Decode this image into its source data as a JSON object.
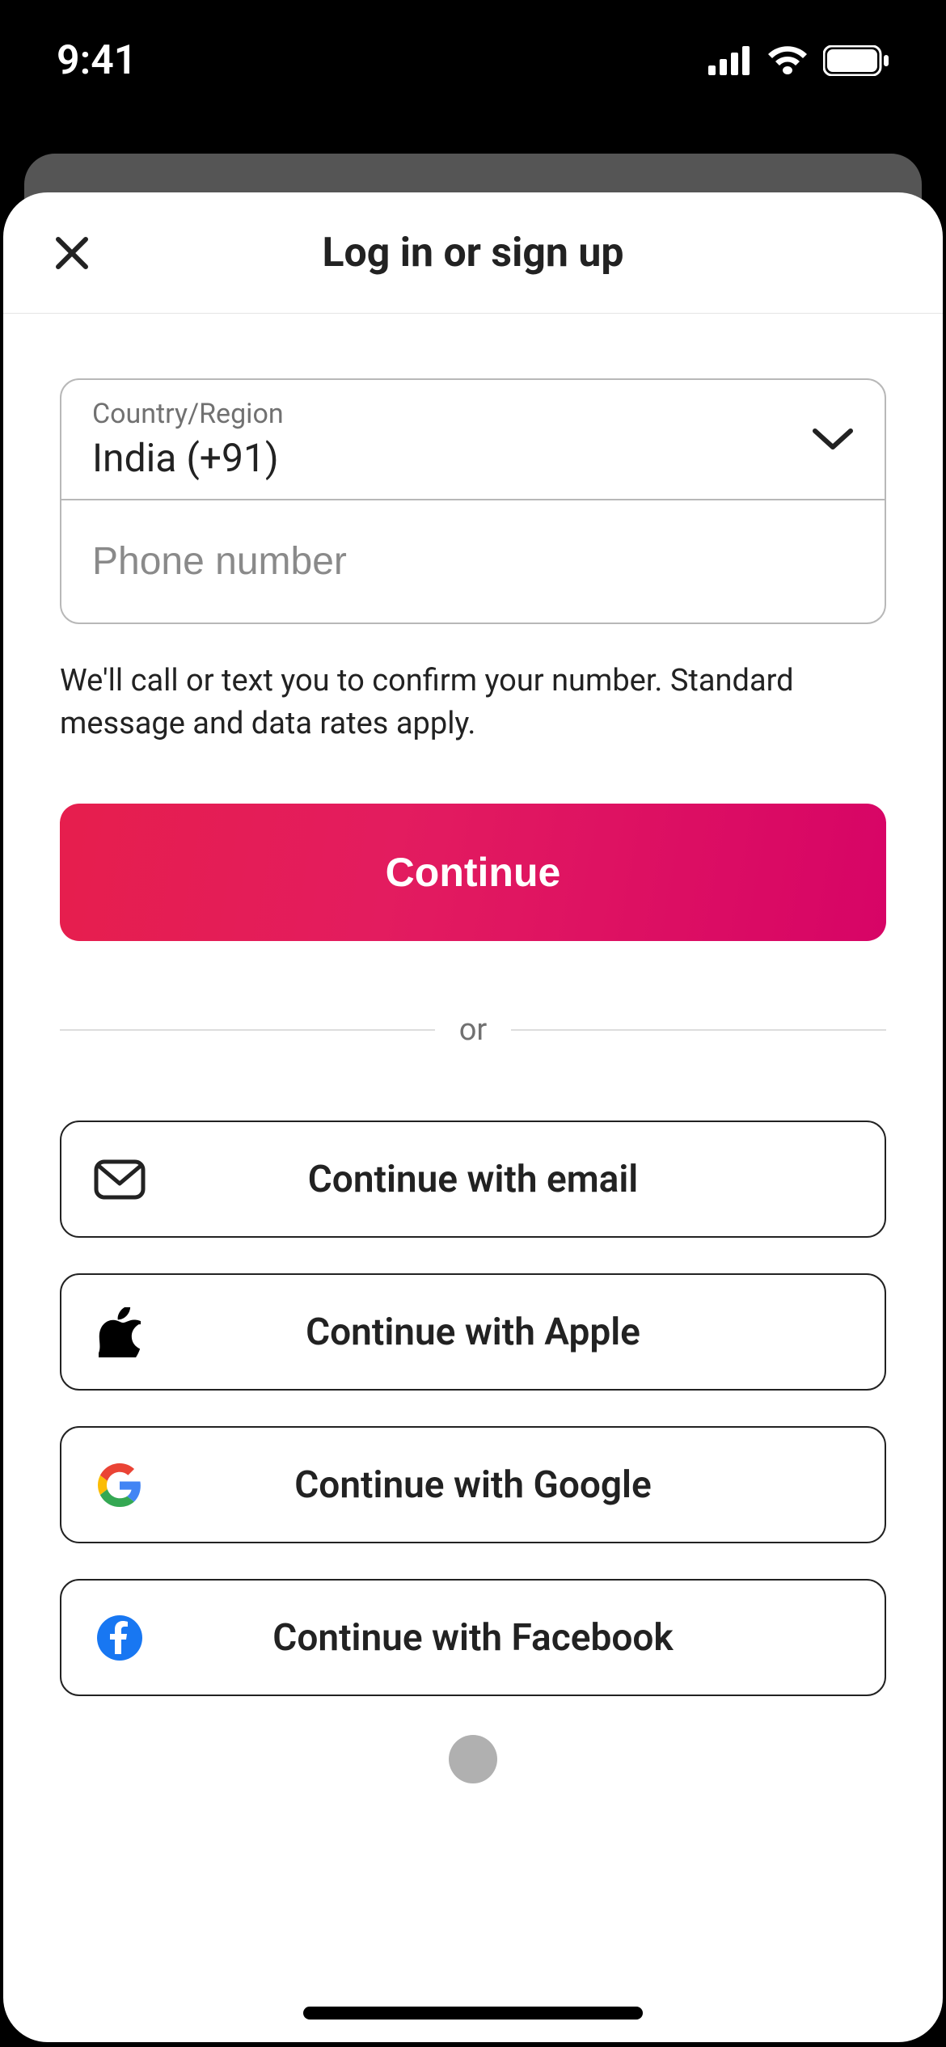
{
  "status": {
    "time": "9:41"
  },
  "header": {
    "title": "Log in or sign up"
  },
  "form": {
    "country_label": "Country/Region",
    "country_value": "India (+91)",
    "phone_placeholder": "Phone number",
    "phone_value": "",
    "disclaimer": "We'll call or text you to confirm your number. Standard message and data rates apply.",
    "continue_label": "Continue"
  },
  "separator": {
    "text": "or"
  },
  "social": {
    "email_label": "Continue with email",
    "apple_label": "Continue with Apple",
    "google_label": "Continue with Google",
    "facebook_label": "Continue with Facebook"
  },
  "colors": {
    "accent_start": "#e61e4d",
    "accent_end": "#d70466",
    "facebook": "#1877F2"
  }
}
